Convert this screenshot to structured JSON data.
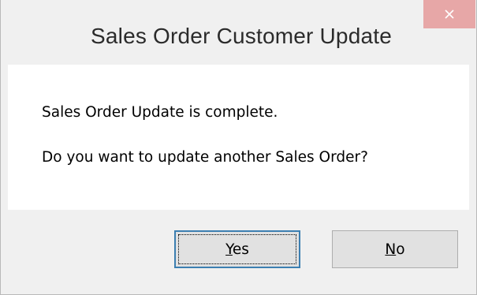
{
  "window": {
    "title": "Sales Order Customer Update",
    "close_icon": "close-icon"
  },
  "message": {
    "line1": "Sales Order Update is complete.",
    "line2": "Do you want to update another Sales Order?"
  },
  "buttons": {
    "yes_label": "Yes",
    "no_label": "No"
  },
  "colors": {
    "close_button_bg": "#e7a7a7",
    "focus_border": "#3c7fb1",
    "button_face": "#e1e1e1"
  }
}
